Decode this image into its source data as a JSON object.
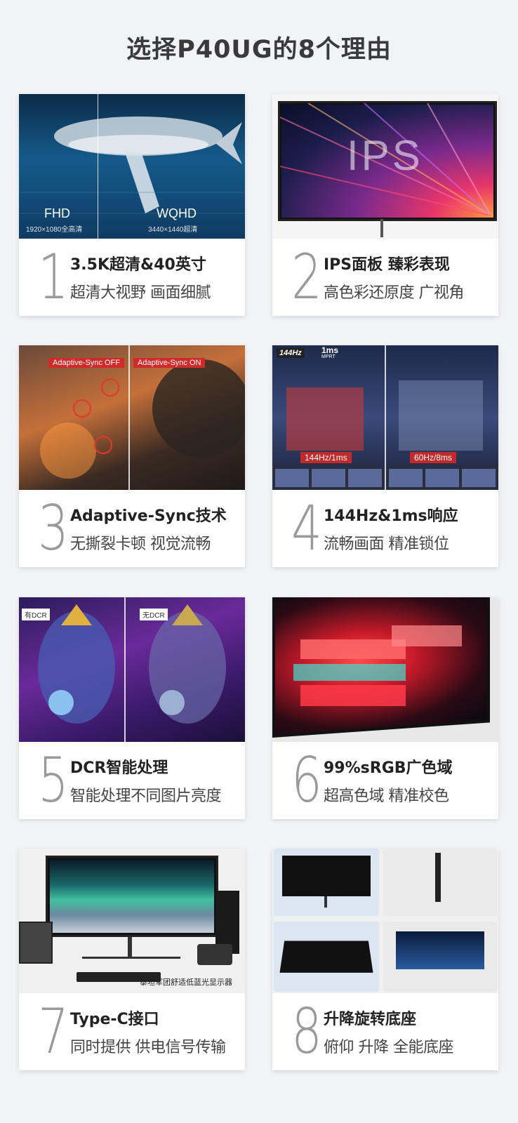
{
  "page": {
    "title": "选择P40UG的8个理由"
  },
  "cards": [
    {
      "number": "1",
      "title": "3.5K超清&40英寸",
      "subtitle": "超清大视野 画面细腻",
      "image_labels": {
        "left": "FHD",
        "left_sub": "1920×1080全高清",
        "right": "WQHD",
        "right_sub": "3440×1440超清"
      }
    },
    {
      "number": "2",
      "title": "IPS面板 臻彩表现",
      "subtitle": "高色彩还原度 广视角",
      "image_labels": {
        "main": "IPS"
      }
    },
    {
      "number": "3",
      "title": "Adaptive-Sync技术",
      "subtitle": "无撕裂卡顿 视觉流畅",
      "image_labels": {
        "left": "Adaptive-Sync OFF",
        "right": "Adaptive-Sync ON"
      }
    },
    {
      "number": "4",
      "title": "144Hz&1ms响应",
      "subtitle": "流畅画面 精准锁位",
      "image_labels": {
        "badge1": "144Hz",
        "badge2": "1ms",
        "badge2_sub": "MPRT",
        "left": "144Hz/1ms",
        "right": "60Hz/8ms"
      }
    },
    {
      "number": "5",
      "title": "DCR智能处理",
      "subtitle": "智能处理不同图片亮度",
      "image_labels": {
        "left": "有DCR",
        "right": "无DCR"
      }
    },
    {
      "number": "6",
      "title": "99%sRGB广色域",
      "subtitle": "超高色域 精准校色",
      "image_labels": {}
    },
    {
      "number": "7",
      "title": "Type-C接口",
      "subtitle": "同时提供 供电信号传输",
      "image_labels": {
        "caption": "泰坦军团舒适低蓝光显示器"
      }
    },
    {
      "number": "8",
      "title": "升降旋转底座",
      "subtitle": "俯仰 升降 全能底座",
      "image_labels": {}
    }
  ],
  "colors": {
    "background": "#f2f3f7",
    "card": "#ffffff",
    "number": "#9a9a9a",
    "title": "#222222"
  }
}
